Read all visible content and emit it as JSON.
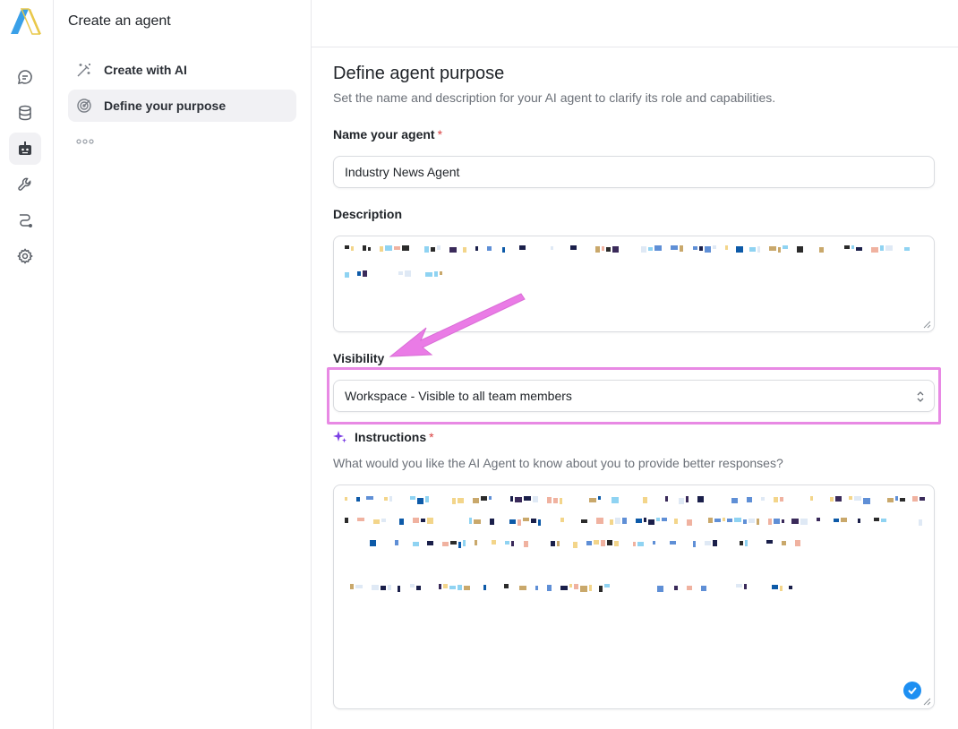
{
  "panel": {
    "title": "Create an agent",
    "nav": [
      {
        "label": "Create with AI",
        "icon": "magic-wand-icon"
      },
      {
        "label": "Define your purpose",
        "icon": "target-icon"
      }
    ]
  },
  "form": {
    "heading": "Define agent purpose",
    "subheading": "Set the name and description for your AI agent to clarify its role and capabilities.",
    "name_label": "Name your agent",
    "name_value": "Industry News Agent",
    "required_mark": "*",
    "description_label": "Description",
    "visibility_label": "Visibility",
    "visibility_value": "Workspace - Visible to all team members",
    "instructions_label": "Instructions",
    "instructions_hint": "What would you like the AI Agent to know about you to provide better responses?"
  },
  "colors": {
    "accent": "#1d8ff2",
    "highlight": "#e889e4",
    "required": "#d93f3f"
  }
}
